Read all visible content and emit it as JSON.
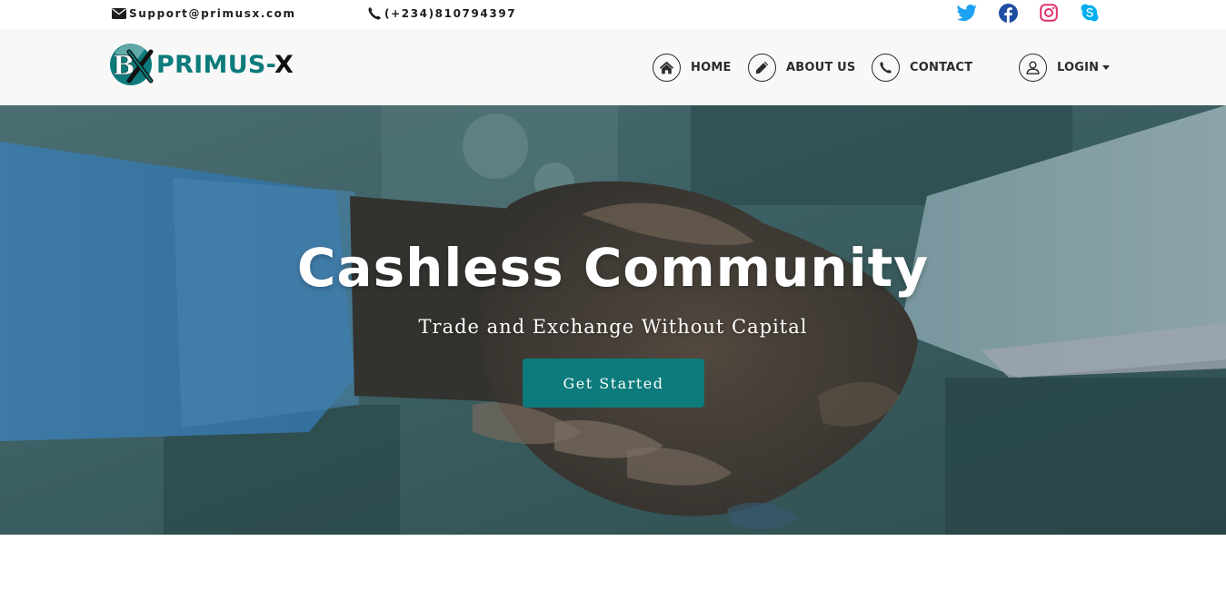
{
  "topbar": {
    "email": "Support@primusx.com",
    "phone": "(+234)810794397",
    "socials": [
      {
        "name": "twitter-icon",
        "color": "#1da1f2"
      },
      {
        "name": "facebook-icon",
        "color": "#1e4fa3"
      },
      {
        "name": "instagram-icon",
        "color": "#e1306c"
      },
      {
        "name": "skype-icon",
        "color": "#00aff0"
      }
    ]
  },
  "brand": {
    "name_primary": "PRIMUS-",
    "name_secondary": "X",
    "logo_letters": "BX",
    "color_primary": "#0d7b7b",
    "color_secondary": "#111111"
  },
  "nav": {
    "home": "HOME",
    "about": "ABOUT US",
    "contact": "CONTACT",
    "login": "LOGIN"
  },
  "hero": {
    "title": "Cashless Community",
    "subtitle": "Trade and Exchange Without Capital",
    "cta": "Get Started",
    "accent": "#0d7b7b"
  }
}
